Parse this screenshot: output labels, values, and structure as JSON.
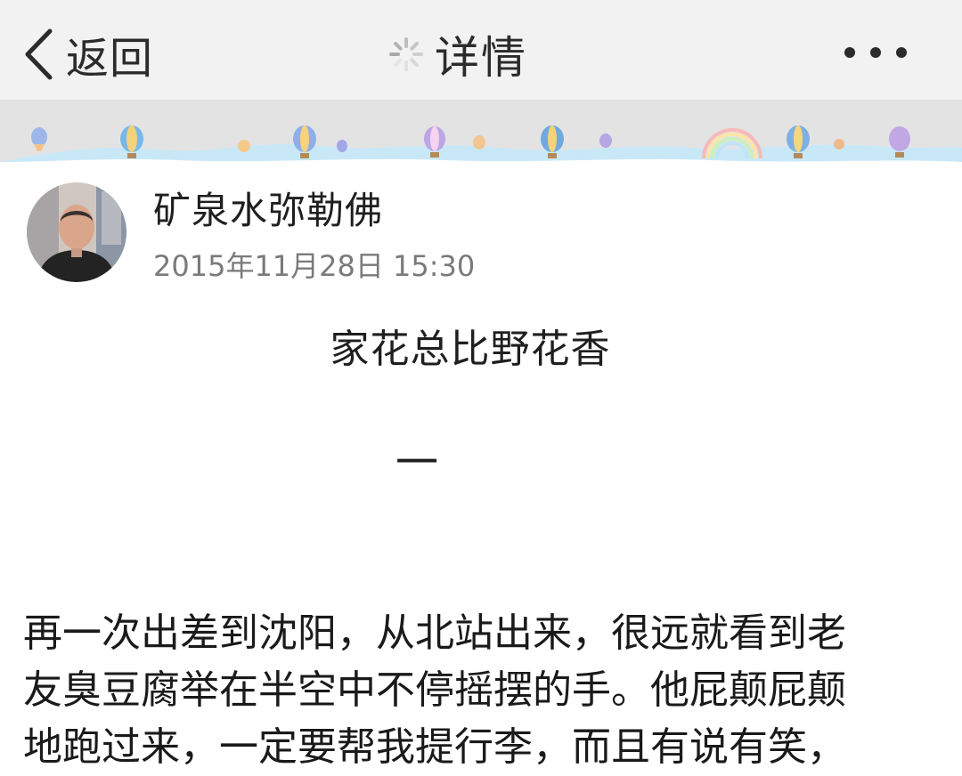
{
  "header": {
    "back_label": "返回",
    "title": "详情",
    "icons": [
      "chevron-left-icon",
      "loading-spinner-icon",
      "more-dots-icon"
    ]
  },
  "post": {
    "author": "矿泉水弥勒佛",
    "date": "2015年11月28日 15:30",
    "title": "家花总比野花香",
    "section_mark": "一",
    "body_lines": [
      "再一次出差到沈阳，从北站出来，很远就看到老",
      "友臭豆腐举在半空中不停摇摆的手。他屁颠屁颠",
      "地跑过来，一定要帮我提行李，而且有说有笑，"
    ]
  },
  "colors": {
    "header_bg": "#f2f2f2",
    "banner_bg": "#e3e3e3",
    "banner_accent": "#a9d8f2",
    "text": "#1f1f1f",
    "meta_text": "#7a7a7a"
  }
}
